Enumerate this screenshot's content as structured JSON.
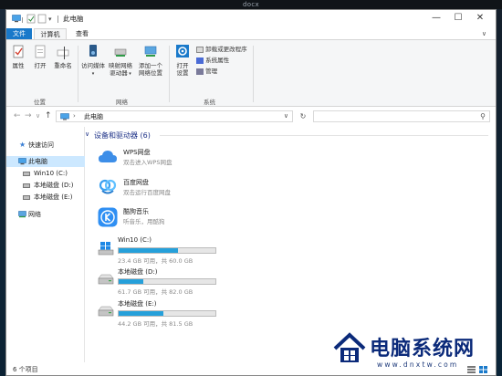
{
  "desktop": {
    "window_caption": "docx"
  },
  "window": {
    "title": "此电脑",
    "controls": {
      "minimize": "—",
      "maximize": "☐",
      "close": "✕"
    }
  },
  "tabs": {
    "file": "文件",
    "computer": "计算机",
    "view": "查看"
  },
  "ribbon": {
    "location": {
      "name": "位置",
      "properties": "属性",
      "open": "打开",
      "rename": "重命名"
    },
    "network": {
      "name": "网络",
      "access_media_line1": "访问媒体",
      "map_drive_line1": "映射网络",
      "map_drive_line2": "驱动器",
      "add_location_line1": "添加一个",
      "add_location_line2": "网络位置"
    },
    "system": {
      "name": "系统",
      "open_settings_line1": "打开",
      "open_settings_line2": "设置",
      "uninstall": "卸载或更改程序",
      "system_properties": "系统属性",
      "manage": "管理"
    }
  },
  "address": {
    "path": "此电脑",
    "back_icon": "←",
    "forward_icon": "→",
    "recent_icon": "∨",
    "up_icon": "↑",
    "dropdown_icon": "∨",
    "refresh_icon": "↻",
    "search_placeholder": "",
    "search_icon": "⚲"
  },
  "navpane": {
    "items": [
      {
        "label": "快速访问",
        "icon": "star-icon"
      },
      {
        "label": "此电脑",
        "icon": "computer-icon",
        "selected": true
      },
      {
        "label": "Win10 (C:)",
        "icon": "drive-icon"
      },
      {
        "label": "本地磁盘 (D:)",
        "icon": "drive-icon"
      },
      {
        "label": "本地磁盘 (E:)",
        "icon": "drive-icon"
      },
      {
        "label": "网络",
        "icon": "network-icon"
      }
    ]
  },
  "content": {
    "group_heading": "设备和驱动器 (6)",
    "apps": [
      {
        "name": "WPS网盘",
        "sub": "双击进入WPS网盘",
        "icon": "wps-cloud-icon",
        "color": "#3d8ee8"
      },
      {
        "name": "百度网盘",
        "sub": "双击运行百度网盘",
        "icon": "baidu-netdisk-icon",
        "color": "#3aa0f0"
      },
      {
        "name": "酷狗音乐",
        "sub": "听音乐，用酷狗",
        "icon": "kugou-icon",
        "color": "#2f8ff3"
      }
    ],
    "drives": [
      {
        "name": "Win10 (C:)",
        "sub": "23.4 GB 可用，共 60.0 GB",
        "used_fraction": 0.61,
        "icon": "windows-drive-icon"
      },
      {
        "name": "本地磁盘 (D:)",
        "sub": "61.7 GB 可用，共 82.0 GB",
        "used_fraction": 0.25,
        "icon": "drive-icon"
      },
      {
        "name": "本地磁盘 (E:)",
        "sub": "44.2 GB 可用，共 81.5 GB",
        "used_fraction": 0.46,
        "icon": "drive-icon"
      }
    ]
  },
  "status": {
    "count_text": "6 个项目"
  },
  "watermark": {
    "site_name": "电脑系统网",
    "url": "www.dnxtw.com"
  },
  "colors": {
    "accent": "#1979ca",
    "drive_fill": "#26a0da",
    "heading": "#1e3287",
    "selected_bg": "#cce8ff"
  }
}
